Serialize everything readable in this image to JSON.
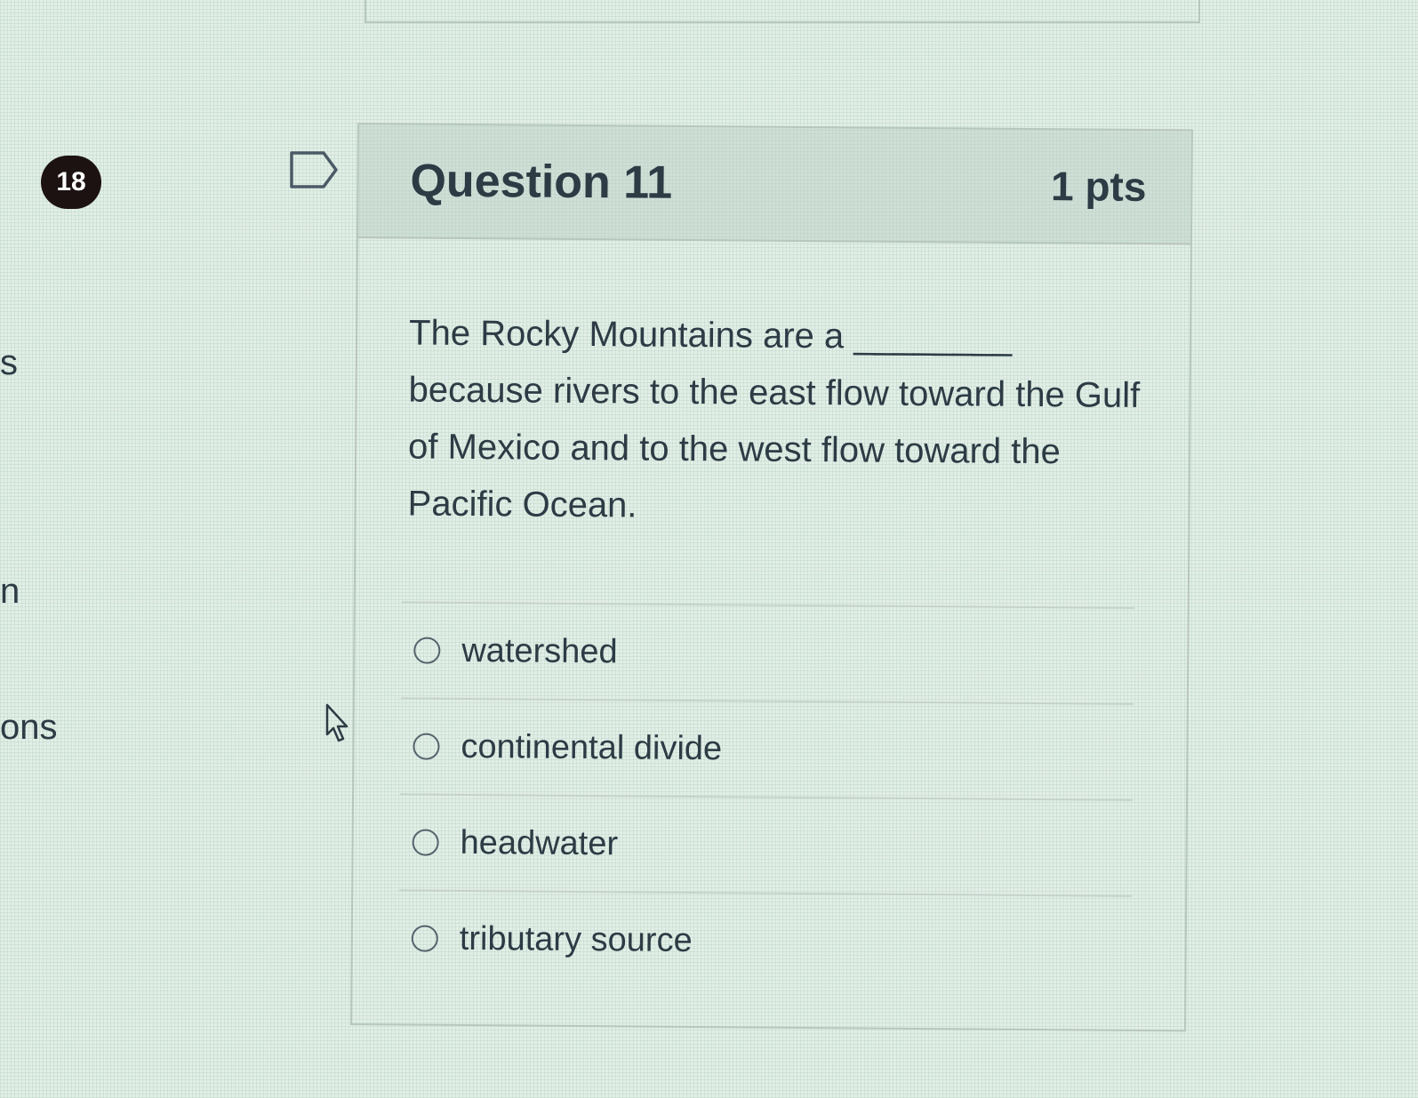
{
  "sidebar": {
    "badge_count": "18",
    "fragments": [
      "s",
      "n",
      "ons"
    ]
  },
  "question": {
    "title": "Question 11",
    "points": "1 pts",
    "text": "The Rocky Mountains are a ________ because rivers to the east flow toward the Gulf of Mexico and to the west flow toward the Pacific Ocean.",
    "answers": [
      {
        "label": "watershed"
      },
      {
        "label": "continental divide"
      },
      {
        "label": "headwater"
      },
      {
        "label": "tributary source"
      }
    ]
  },
  "icons": {
    "flag": "flag-question-icon",
    "cursor": "mouse-pointer-icon"
  }
}
